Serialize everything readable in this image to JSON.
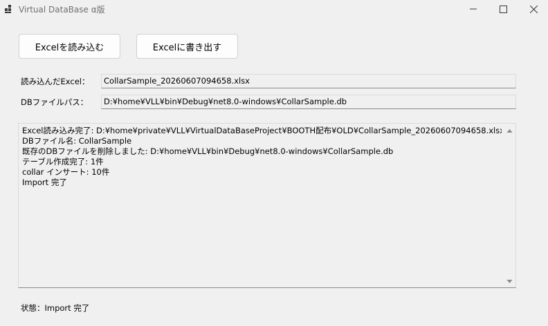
{
  "window": {
    "title": "Virtual DataBase α版"
  },
  "toolbar": {
    "import_label": "Excelを読み込む",
    "export_label": "Excelに書き出す"
  },
  "fields": {
    "excel_label": "読み込んだExcel：",
    "excel_value": "CollarSample_20260607094658.xlsx",
    "db_label": "DBファイルパス：",
    "db_value": "D:¥home¥VLL¥bin¥Debug¥net8.0-windows¥CollarSample.db"
  },
  "log": {
    "lines": [
      "Excel読み込み完了: D:¥home¥private¥VLL¥VirtualDataBaseProject¥BOOTH配布¥OLD¥CollarSample_20260607094658.xlsx",
      "DBファイル名: CollarSample",
      "既存のDBファイルを削除しました: D:¥home¥VLL¥bin¥Debug¥net8.0-windows¥CollarSample.db",
      "テーブル作成完了: 1件",
      "collar インサート: 10件",
      "Import 完了"
    ]
  },
  "status": {
    "text": "状態：Import 完了"
  },
  "icons": {
    "app": "app-icon",
    "minimize": "minimize-icon",
    "maximize": "maximize-icon",
    "close": "close-icon",
    "scroll_up": "scroll-up-arrow-icon",
    "scroll_down": "scroll-down-arrow-icon"
  },
  "colors": {
    "background": "#f0f0f0",
    "button_face": "#fdfdfd",
    "button_border": "#d1d1d1",
    "title_text": "#6f6f6f"
  }
}
